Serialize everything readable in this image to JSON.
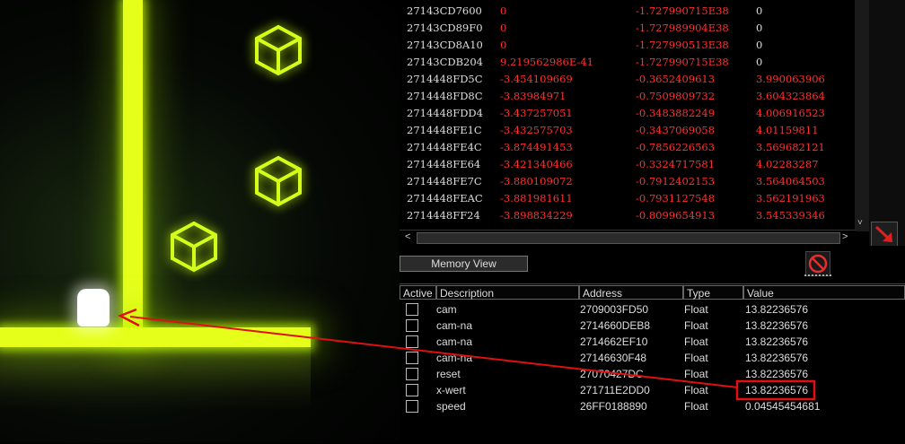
{
  "game": {
    "description_icons": [
      "cube-icon",
      "cube-icon",
      "cube-icon"
    ],
    "colors": {
      "neon": "#e6ff1a",
      "player": "#ffffff"
    }
  },
  "memory_view": {
    "rows": [
      {
        "addr": "27143CD7600",
        "v1": "0",
        "v2": "-1.727990715E38",
        "v3": "0"
      },
      {
        "addr": "27143CD89F0",
        "v1": "0",
        "v2": "-1.727989904E38",
        "v3": "0"
      },
      {
        "addr": "27143CD8A10",
        "v1": "0",
        "v2": "-1.727990513E38",
        "v3": "0"
      },
      {
        "addr": "27143CDB204",
        "v1": "9.219562986E-41",
        "v2": "-1.727990715E38",
        "v3": "0"
      },
      {
        "addr": "2714448FD5C",
        "v1": "-3.454109669",
        "v2": "-0.3652409613",
        "v3": "3.990063906"
      },
      {
        "addr": "2714448FD8C",
        "v1": "-3.83984971",
        "v2": "-0.7509809732",
        "v3": "3.604323864"
      },
      {
        "addr": "2714448FDD4",
        "v1": "-3.437257051",
        "v2": "-0.3483882249",
        "v3": "4.006916523"
      },
      {
        "addr": "2714448FE1C",
        "v1": "-3.432575703",
        "v2": "-0.3437069058",
        "v3": "4.01159811"
      },
      {
        "addr": "2714448FE4C",
        "v1": "-3.874491453",
        "v2": "-0.7856226563",
        "v3": "3.569682121"
      },
      {
        "addr": "2714448FE64",
        "v1": "-3.421340466",
        "v2": "-0.3324717581",
        "v3": "4.02283287"
      },
      {
        "addr": "2714448FE7C",
        "v1": "-3.880109072",
        "v2": "-0.7912402153",
        "v3": "3.564064503"
      },
      {
        "addr": "2714448FEAC",
        "v1": "-3.881981611",
        "v2": "-0.7931127548",
        "v3": "3.562191963"
      },
      {
        "addr": "2714448FF24",
        "v1": "-3.898834229",
        "v2": "-0.8099654913",
        "v3": "3.545339346"
      }
    ],
    "hscroll_left": "<",
    "hscroll_right": ">",
    "vscroll_down": "˅"
  },
  "toolbar": {
    "memory_view_label": "Memory View"
  },
  "table": {
    "headers": {
      "active": "Active",
      "description": "Description",
      "address": "Address",
      "type": "Type",
      "value": "Value"
    },
    "rows": [
      {
        "description": "cam",
        "address": "2709003FD50",
        "type": "Float",
        "value": "13.82236576"
      },
      {
        "description": "cam-na",
        "address": "2714660DEB8",
        "type": "Float",
        "value": "13.82236576"
      },
      {
        "description": "cam-na",
        "address": "2714662EF10",
        "type": "Float",
        "value": "13.82236576"
      },
      {
        "description": "cam-na",
        "address": "27146630F48",
        "type": "Float",
        "value": "13.82236576"
      },
      {
        "description": "reset",
        "address": "27070427DC",
        "type": "Float",
        "value": "13.82236576"
      },
      {
        "description": "x-wert",
        "address": "271711E2DD0",
        "type": "Float",
        "value": "13.82236576"
      },
      {
        "description": "speed",
        "address": "26FF0188890",
        "type": "Float",
        "value": "0.04545454681"
      }
    ]
  },
  "annotation": {
    "color": "#e01010"
  }
}
